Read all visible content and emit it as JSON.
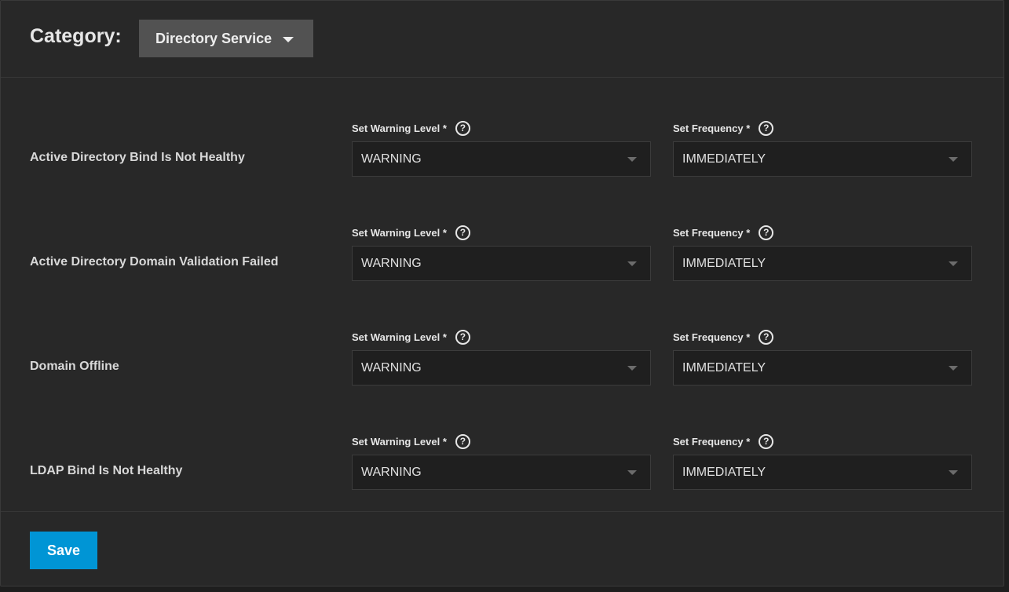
{
  "header": {
    "category_label": "Category:",
    "category_value": "Directory Service"
  },
  "field_labels": {
    "warning_level": "Set Warning Level *",
    "frequency": "Set Frequency *",
    "help_glyph": "?"
  },
  "alerts": [
    {
      "label": "Active Directory Bind Is Not Healthy",
      "warning_level": "WARNING",
      "frequency": "IMMEDIATELY"
    },
    {
      "label": "Active Directory Domain Validation Failed",
      "warning_level": "WARNING",
      "frequency": "IMMEDIATELY"
    },
    {
      "label": "Domain Offline",
      "warning_level": "WARNING",
      "frequency": "IMMEDIATELY"
    },
    {
      "label": "LDAP Bind Is Not Healthy",
      "warning_level": "WARNING",
      "frequency": "IMMEDIATELY"
    }
  ],
  "footer": {
    "save_label": "Save"
  },
  "colors": {
    "accent": "#0095d5",
    "panel": "#282828",
    "select_bg": "#1f1f1f",
    "category_button": "#525252"
  },
  "icons": {
    "help": "help-circle-icon",
    "dropdown": "chevron-down-icon"
  }
}
